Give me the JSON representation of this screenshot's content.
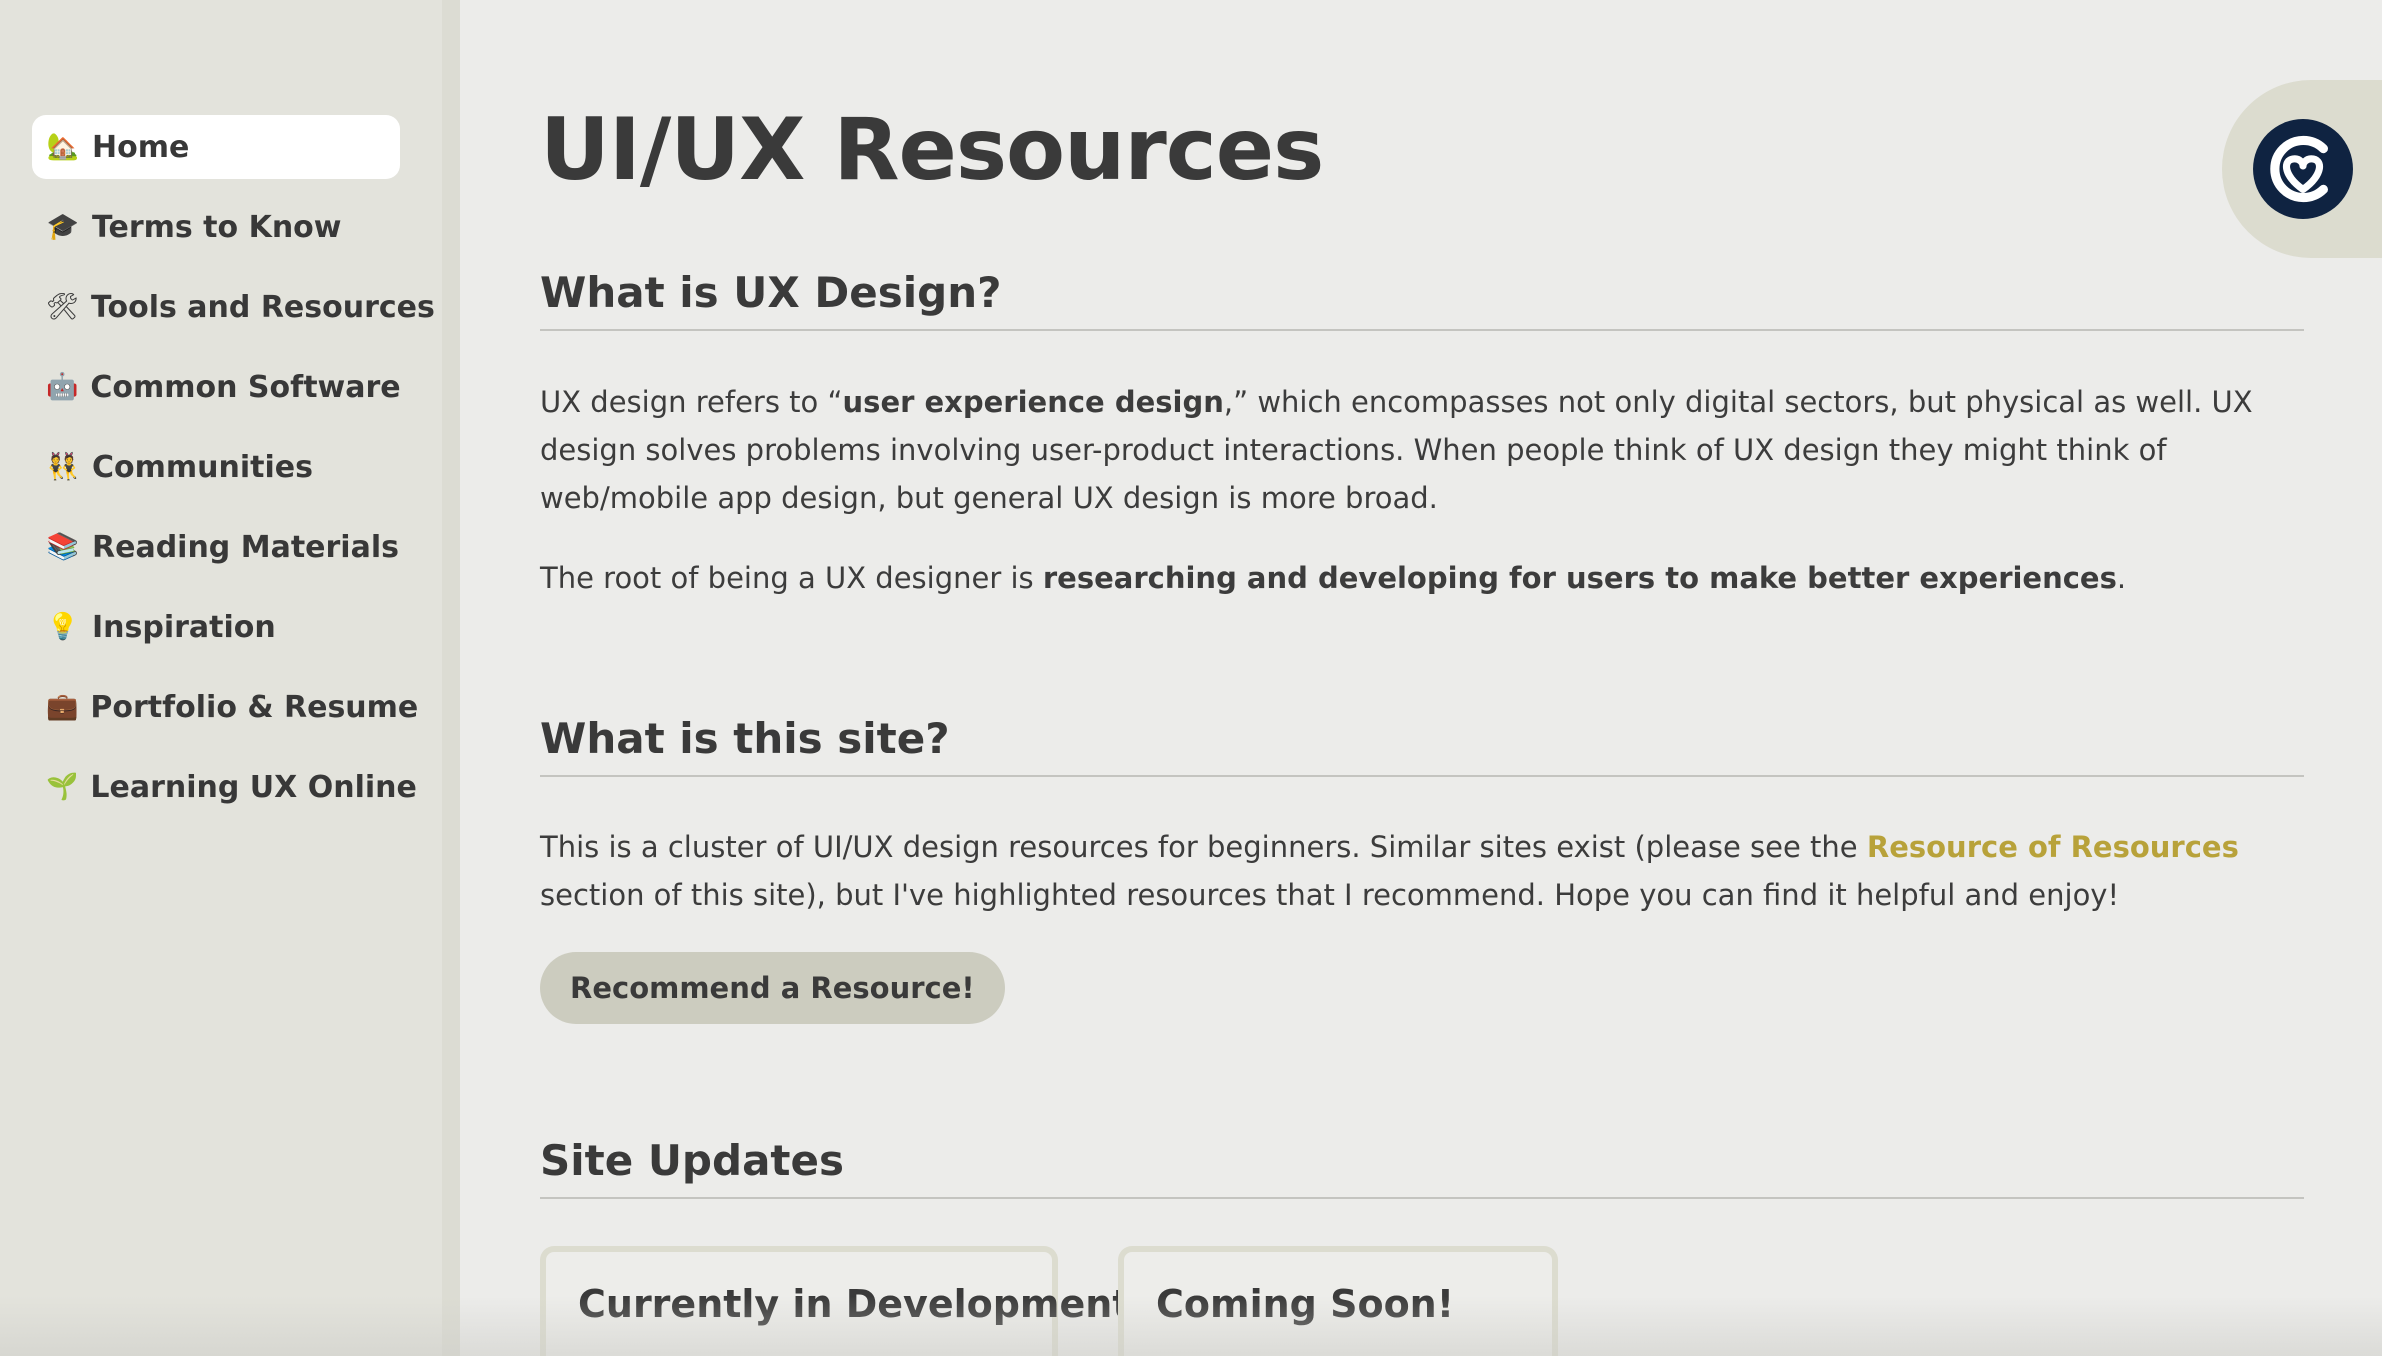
{
  "sidebar": {
    "items": [
      {
        "icon": "🏡",
        "icon_name": "house-icon",
        "label": "Home",
        "active": true
      },
      {
        "icon": "🎓",
        "icon_name": "graduation-cap-icon",
        "label": "Terms to Know"
      },
      {
        "icon": "🛠",
        "icon_name": "tools-icon",
        "label": "Tools and Resources"
      },
      {
        "icon": "🤖",
        "icon_name": "robot-icon",
        "label": "Common Software"
      },
      {
        "icon": "👯",
        "icon_name": "people-icon",
        "label": "Communities"
      },
      {
        "icon": "📚",
        "icon_name": "books-icon",
        "label": "Reading Materials"
      },
      {
        "icon": "💡",
        "icon_name": "lightbulb-icon",
        "label": "Inspiration"
      },
      {
        "icon": "💼",
        "icon_name": "briefcase-icon",
        "label": "Portfolio & Resume"
      },
      {
        "icon": "🌱",
        "icon_name": "seedling-icon",
        "label": "Learning UX Online"
      }
    ]
  },
  "main": {
    "title": "UI/UX Resources",
    "section1": {
      "heading": "What is UX Design?",
      "p1_a": "UX design refers to “",
      "p1_bold": "user experience design",
      "p1_b": ",” which encompasses not only digital sectors, but physical as well. UX design solves problems involving user-product interactions. When people think of UX design they might think of web/mobile app design, but general UX design is more broad.",
      "p2_a": "The root of being a UX designer is ",
      "p2_bold": "researching and developing for users to make better experiences",
      "p2_b": "."
    },
    "section2": {
      "heading": "What is this site?",
      "p1_a": "This is a cluster of UI/UX design resources for beginners. Similar sites exist (please see the ",
      "p1_link": "Resource of Resources",
      "p1_b": " section of this site), but I've highlighted resources that I recommend. Hope you can find it helpful and enjoy!",
      "button": "Recommend a Resource!"
    },
    "section3": {
      "heading": "Site Updates",
      "cards": [
        "Currently in Development",
        "Coming Soon!"
      ]
    }
  },
  "badge": {
    "icon_name": "heart-logo-icon"
  },
  "colors": {
    "sidebar_bg": "#e3e3dc",
    "page_bg": "#ececea",
    "link": "#b8a23a",
    "button_bg": "#ccccbf",
    "logo_dark": "#0f2341"
  }
}
